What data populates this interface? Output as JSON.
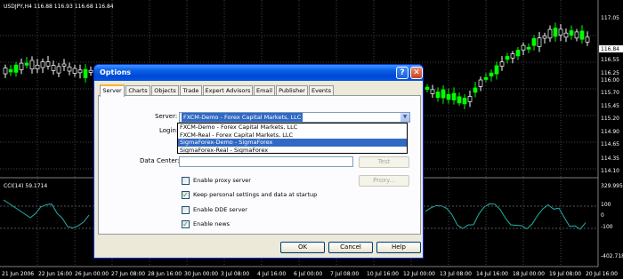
{
  "chart": {
    "title": "USDJPY,H4  116.88 116.93 116.68 116.84",
    "price_ticks": [
      "117.05",
      "116.84",
      "116.55",
      "116.25",
      "116.00",
      "115.70",
      "115.45",
      "115.20",
      "114.90",
      "114.65",
      "114.35",
      "114.10"
    ],
    "current_price": "116.84",
    "indicator_title": "CCI(14) 59.1714",
    "indicator_ticks": [
      "329.9959",
      "100",
      "0",
      "-100",
      "-402.7187"
    ],
    "date_ticks": [
      "21 Jun 2006",
      "22 Jun 16:00",
      "26 Jun 00:00",
      "27 Jun 08:00",
      "28 Jun 16:00",
      "30 Jun 00:00",
      "3 Jul 08:00",
      "4 Jul 16:00",
      "6 Jul 00:00",
      "7 Jul 08:00",
      "10 Jul 16:00",
      "12 Jul 00:00",
      "13 Jul 08:00",
      "14 Jul 16:00",
      "18 Jul 00:00",
      "19 Jul 08:00",
      "20 Jul 16:00"
    ],
    "colors": {
      "background": "#000000",
      "bull": "#00ff00",
      "bear": "#ffffff",
      "cci": "#20b2aa"
    }
  },
  "dialog": {
    "title": "Options",
    "help_symbol": "?",
    "close_symbol": "✕",
    "tabs": [
      "Server",
      "Charts",
      "Objects",
      "Trade",
      "Expert Advisors",
      "Email",
      "Publisher",
      "Events"
    ],
    "server_label": "Server:",
    "server_value": "FXCM-Demo - Forex Capital Markets, LLC",
    "login_label": "Login:",
    "datacenter_label": "Data Center:",
    "test_button": "Test",
    "proxy_button": "Proxy...",
    "dropdown_options": [
      "FXCM-Demo - Forex Capital Markets, LLC",
      "FXCM-Real - Forex Capital Markets, LLC",
      "SigmaForex-Demo - SigmaForex",
      "SigmaForex-Real - SigmaForex"
    ],
    "checkboxes": [
      {
        "label": "Enable proxy server",
        "checked": false
      },
      {
        "label": "Keep personal settings and data at startup",
        "checked": true
      },
      {
        "label": "Enable DDE server",
        "checked": false
      },
      {
        "label": "Enable news",
        "checked": true
      }
    ],
    "ok_button": "OK",
    "cancel_button": "Cancel",
    "help_button": "Help"
  }
}
